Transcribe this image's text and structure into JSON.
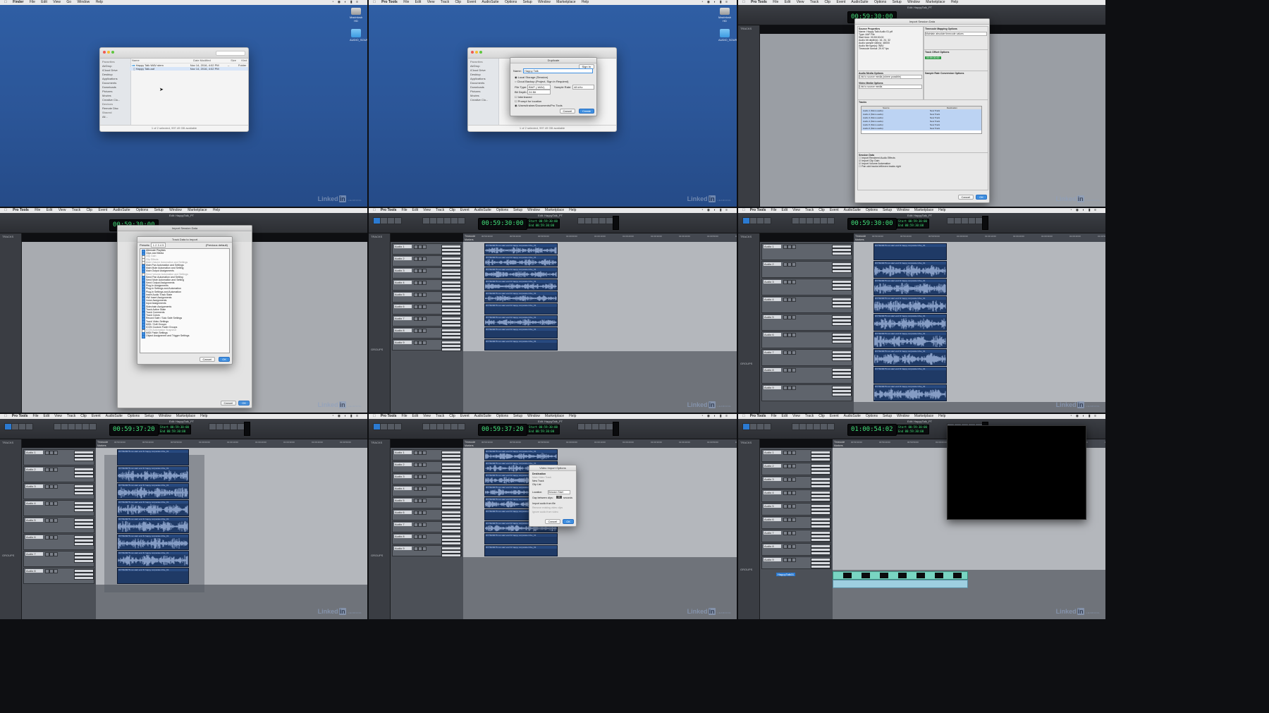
{
  "menus": {
    "finder": [
      "File",
      "Edit",
      "View",
      "Go",
      "Window",
      "Help"
    ],
    "protools": [
      "Pro Tools",
      "File",
      "Edit",
      "View",
      "Track",
      "Clip",
      "Event",
      "AudioSuite",
      "Options",
      "Setup",
      "Window",
      "Marketplace",
      "Help"
    ]
  },
  "watermark": {
    "brand": "Linked",
    "in": "in",
    "suffix": "LEARNING"
  },
  "desktop": {
    "icon1": "Macintosh HD",
    "icon2": "AUDIO_SOURCE_FILES"
  },
  "finder": {
    "favorites_header": "Favorites",
    "sidebar": [
      "AirDrop",
      "iCloud Drive",
      "Desktop",
      "Applications",
      "Documents",
      "Downloads",
      "Pictures",
      "Movies",
      "Creative Clo..."
    ],
    "devices_header": "Devices",
    "devices": [
      "Remote Disc"
    ],
    "shared_header": "Shared",
    "shared": [
      "All..."
    ],
    "columns": [
      "Name",
      "Date Modified",
      "Size",
      "Kind"
    ],
    "rows": [
      {
        "name": "Happy Talk WAV stem",
        "date": "Nov 14, 2016, 4:02 PM",
        "size": "--",
        "kind": "Folder"
      },
      {
        "name": "Happy Talk.aaf",
        "date": "Nov 14, 2016, 4:02 PM",
        "size": "",
        "kind": ""
      }
    ],
    "status": "1 of 2 selected, 997.49 GB available"
  },
  "duplicate_dialog": {
    "title": "Duplicate",
    "name_label": "Name:",
    "name_value": "Happy Talk",
    "opt1": "Local Storage (Session)",
    "opt2": "Cloud Backup (Project, Sign in Required)",
    "file_type_label": "File Type:",
    "file_type": "BWF (.WAV)",
    "sample_rate_label": "Sample Rate:",
    "sample_rate": "48 kHz",
    "bit_depth_label": "Bit Depth:",
    "bit_depth": "24 Bit",
    "interleaved": "Interleaved",
    "prompt": "Prompt for location",
    "location": "/Users/trainer/Documents/Pro Tools",
    "sign_in": "Sign In",
    "cancel": "Cancel",
    "ok": "Create"
  },
  "import_session": {
    "title": "Import Session Data",
    "source_properties_header": "Source Properties",
    "source_props": [
      "Name: Happy Talk Audio 01.ptf",
      "Type: AAF File",
      "Start time: 00:59:30:00",
      "Audio bit depth(s): 16, 24, 32",
      "Audio sample rate(s): 48000",
      "Audio file type(s): WAV",
      "Timecode format: 29.97 fps"
    ],
    "timecode_mapping_header": "Timecode Mapping Options",
    "timecode_mapping": "Maintain absolute timecode values",
    "track_offset_header": "Track Offset Options",
    "audio_media_header": "Audio Media Options",
    "audio_media_value": "Link to source media (where possible)",
    "video_media_header": "Video Media Options",
    "video_media_value": "Link to source media",
    "sample_rate_header": "Sample Rate Conversion Options",
    "tracks_header": "Tracks",
    "source_col": "Source",
    "dest_col": "Destination",
    "tracks": [
      "Audio 1 (Mono audio)",
      "Audio 2 (Mono audio)",
      "Audio 3 (Mono audio)",
      "Audio 4 (Mono audio)",
      "Audio 5 (Mono audio)",
      "Audio 6 (Mono audio)"
    ],
    "dest": "New Track",
    "session_data_header": "Session Data",
    "session_opts": [
      "Import Rendered Audio Effects",
      "Import Clip Gain",
      "Import Volume Automation",
      "Pan odd tracks left/even tracks right"
    ],
    "cancel": "Cancel",
    "ok": "OK"
  },
  "track_data_dialog": {
    "title": "Track Data to Import",
    "presets_label": "Presets:",
    "presets": "1 2 3 4 5",
    "all_label": "(Previous default)",
    "items": [
      {
        "label": "Alternate Playlists",
        "on": true
      },
      {
        "label": "Clips and Media",
        "on": true
      },
      {
        "label": "Clip Gain",
        "on": false
      },
      {
        "label": "Clip Effects",
        "on": false
      },
      {
        "label": "Main Volume Automation and Settings",
        "on": false
      },
      {
        "label": "Main Pan Automation and Settings",
        "on": true
      },
      {
        "label": "Main Mute Automation and Setting",
        "on": true
      },
      {
        "label": "Main Output Assignments",
        "on": true
      },
      {
        "label": "Send Volume Automation and Settings",
        "on": false
      },
      {
        "label": "Send Pan Automation and Setting",
        "on": true
      },
      {
        "label": "Send Mute Automation and Setting",
        "on": true
      },
      {
        "label": "Send Output Assignments",
        "on": true
      },
      {
        "label": "Plug-In Assignments",
        "on": true
      },
      {
        "label": "Plug-In Settings and Automation",
        "on": true
      },
      {
        "label": "Plug-In Settings and Automation",
        "on": true
      },
      {
        "label": "Insert Audio Track State",
        "on": true
      },
      {
        "label": "HW Insert Assignments",
        "on": true
      },
      {
        "label": "Voice Assignments",
        "on": true
      },
      {
        "label": "Input Assignments",
        "on": true
      },
      {
        "label": "Sidechain Assignments",
        "on": true
      },
      {
        "label": "Track Active State",
        "on": true
      },
      {
        "label": "Track Comments",
        "on": true
      },
      {
        "label": "Track Colors",
        "on": true
      },
      {
        "label": "Record Safe / Solo Safe Settings",
        "on": true
      },
      {
        "label": "Track Video Settings",
        "on": true
      },
      {
        "label": "MIDI / Soft Groups",
        "on": true
      },
      {
        "label": "ICON Custom Fader Groups",
        "on": true
      },
      {
        "label": "ICON Automation Snapshot",
        "on": false
      },
      {
        "label": "MIDI Patch Settings",
        "on": true
      },
      {
        "label": "Object Assignment and Trigger Settings",
        "on": true
      }
    ],
    "cancel": "Cancel",
    "ok": "OK"
  },
  "video_import": {
    "title": "Video Import Options",
    "destination_label": "Destination",
    "opt_main": "Main Video Track",
    "opt_new": "New Track",
    "opt_clip": "Clip List",
    "location_label": "Location:",
    "location_value": "Session Start",
    "gap_label": "Gap between clips:",
    "gap_value": "0",
    "gap_unit": "seconds",
    "import_audio": "Import audio from file",
    "remove_existing": "Remove existing video clips",
    "ignore_audio": "Ignore audio from video",
    "cancel": "Cancel",
    "ok": "OK"
  },
  "protools": {
    "window_title": "Edit: HappyTalk_PT",
    "tracks_label": "TRACKS",
    "groups_label": "GROUPS",
    "timecode_label": "Timecode",
    "markers_label": "Markers",
    "counters": [
      "00:59:30:00",
      "00:59:30:00",
      "00:59:30:00",
      "00:59:30:00",
      "00:59:30:00",
      "00:59:37:20",
      "00:59:37:20",
      "01:00:54:02"
    ],
    "sub_counters": [
      "Start 00:59:30:00",
      "End 00:59:30:00",
      "Length 00:00:00:00"
    ],
    "ruler_ticks": [
      "00:59:30:00",
      "00:59:40:00",
      "00:59:50:00",
      "01:00:00:00",
      "01:00:10:00",
      "01:00:20:00",
      "01:00:30:00",
      "01:00:40:00",
      "01:00:50:00",
      "01:01:00:00",
      "01:01:10:00"
    ],
    "track_names": [
      "Audio 1",
      "Audio 2",
      "Audio 3",
      "Audio 4",
      "Audio 5",
      "Audio 6",
      "Audio 7",
      "Audio 8",
      "Audio 9"
    ],
    "clip_name": "DVTR20078 not start end fit happy corporate tribe_01",
    "video_track_name": "HappyTalk01"
  }
}
